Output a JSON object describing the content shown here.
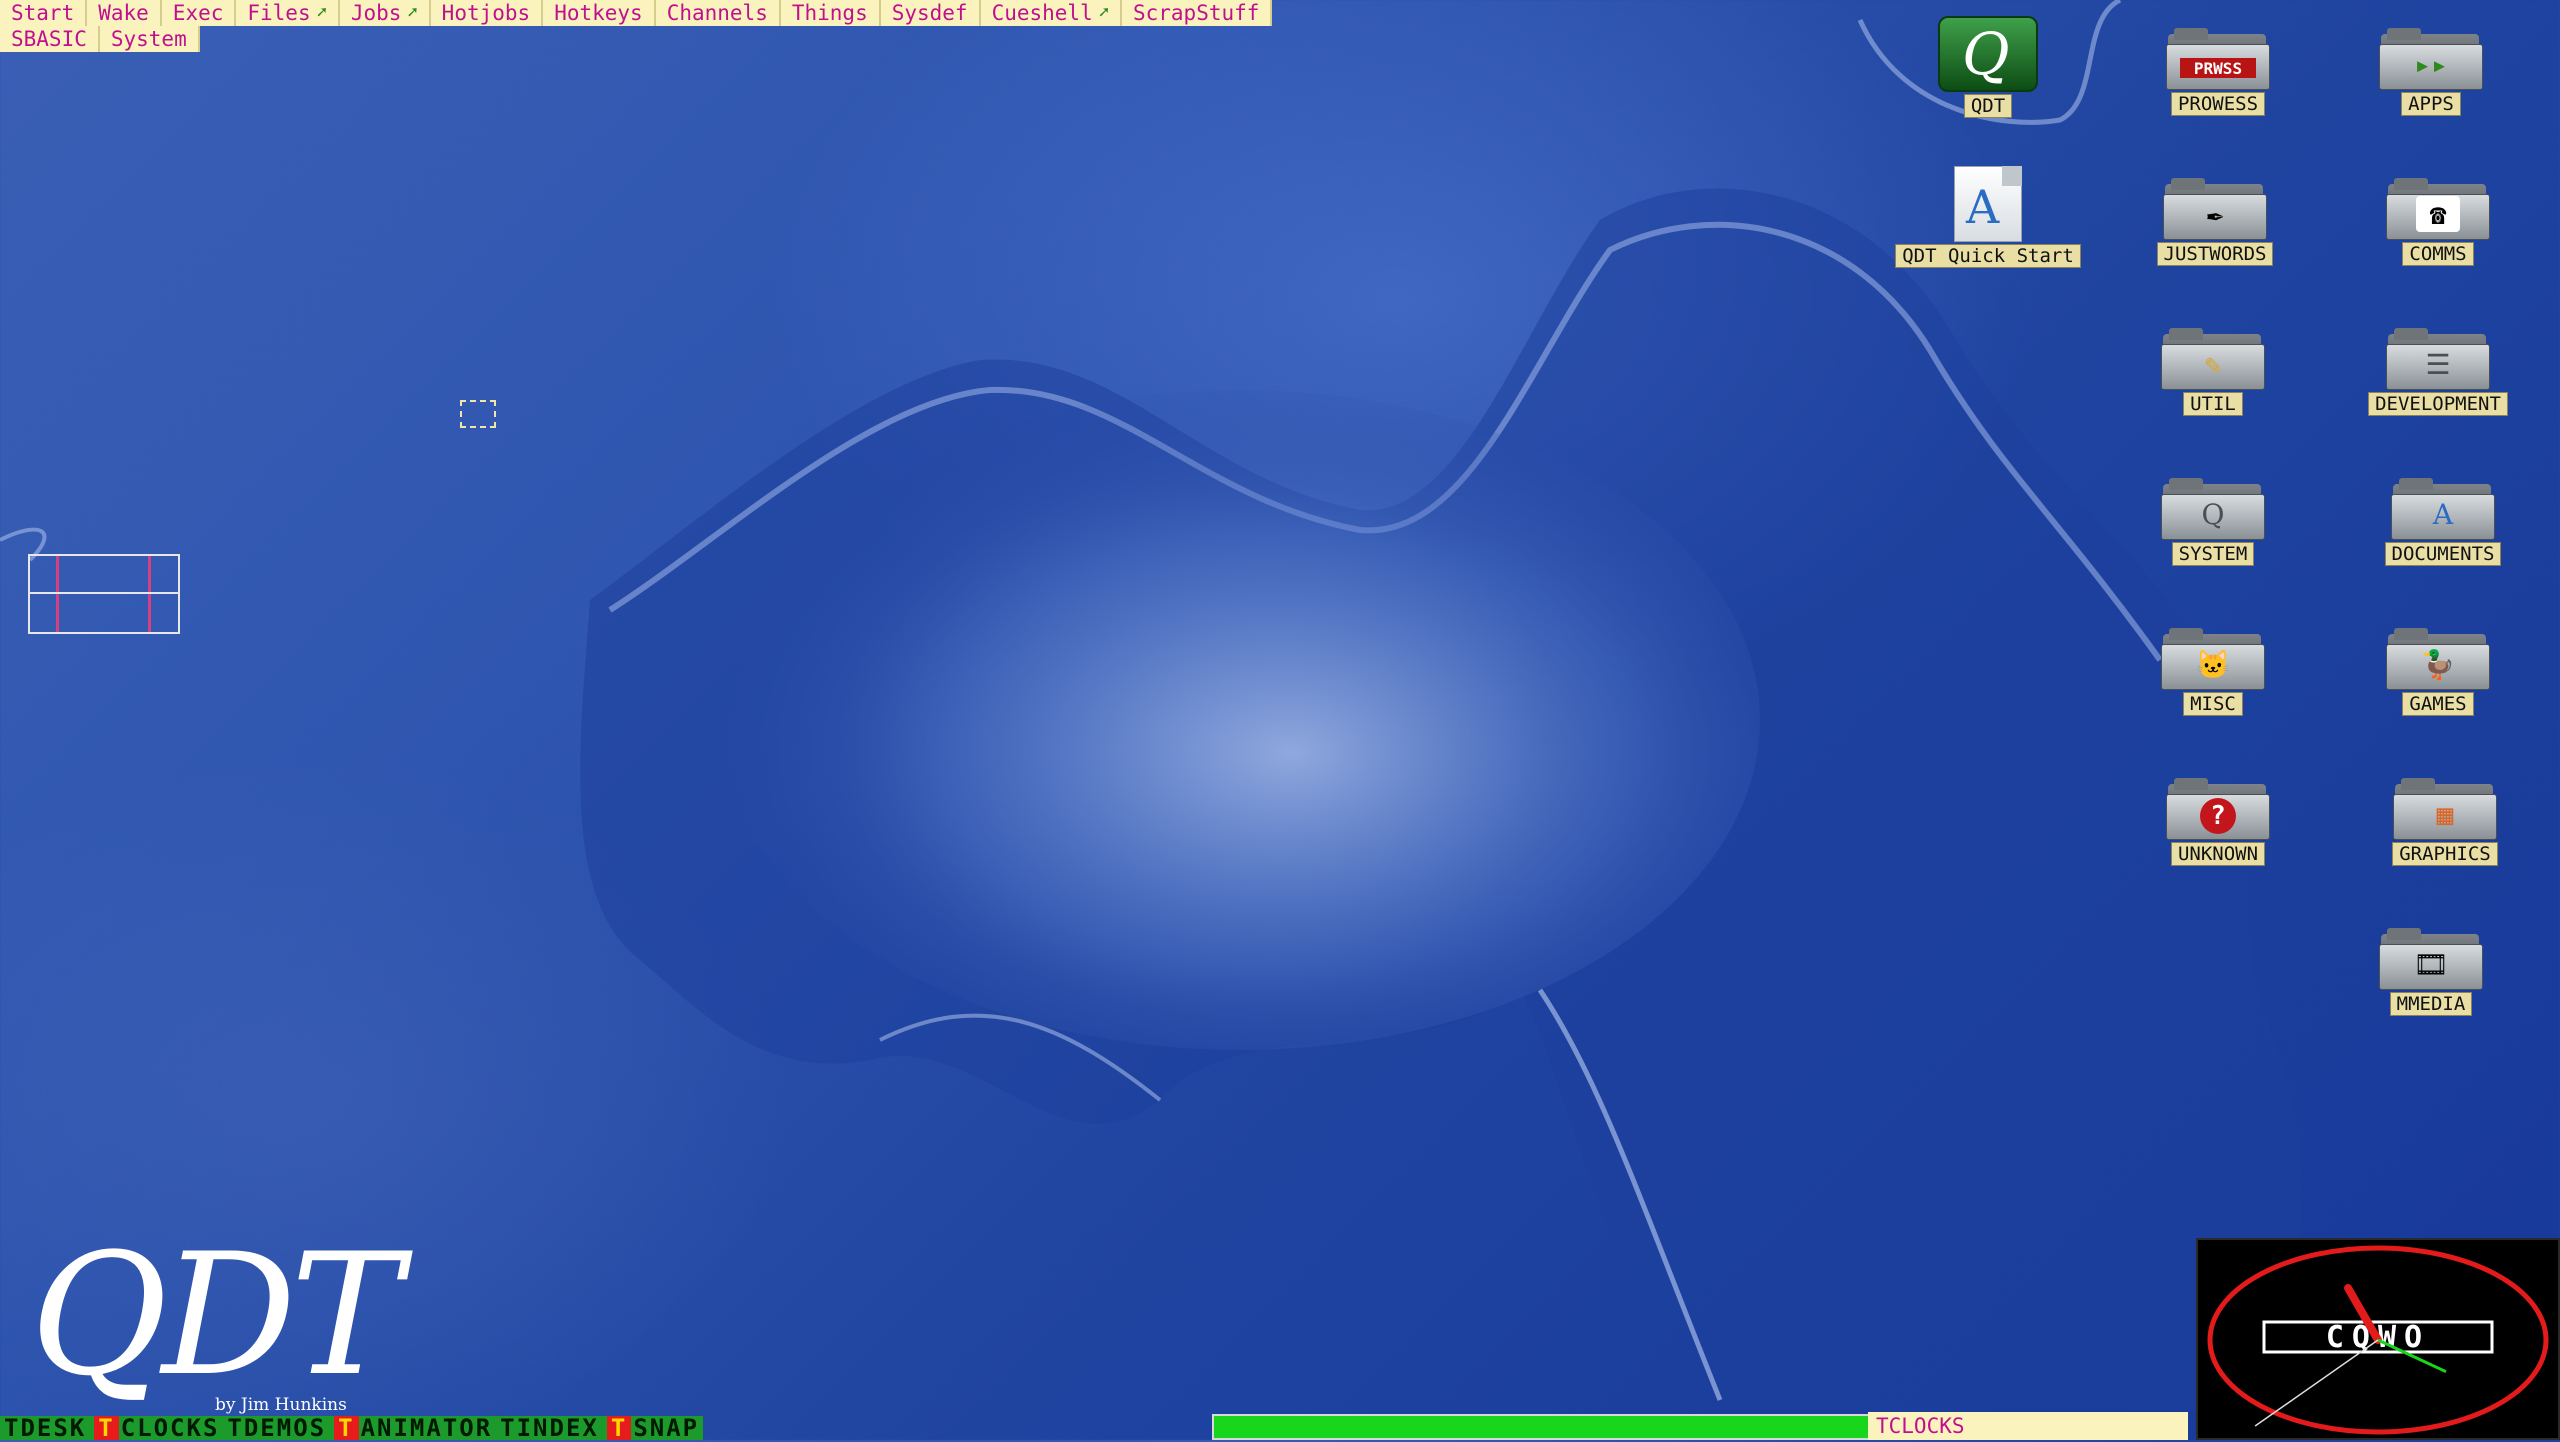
{
  "menubar": {
    "row1": [
      {
        "label": "Start"
      },
      {
        "label": "Wake"
      },
      {
        "label": "Exec"
      },
      {
        "label": "Files",
        "arrow": "➚"
      },
      {
        "label": "Jobs",
        "arrow": "➚"
      },
      {
        "label": "Hotjobs"
      },
      {
        "label": "Hotkeys"
      },
      {
        "label": "Channels"
      },
      {
        "label": "Things"
      },
      {
        "label": "Sysdef"
      },
      {
        "label": "Cueshell",
        "arrow": "➚"
      },
      {
        "label": "ScrapStuff"
      }
    ],
    "row2": [
      {
        "label": "SBASIC"
      },
      {
        "label": "System"
      }
    ]
  },
  "icons": {
    "qdt": {
      "label": "QDT",
      "icon": "qdt-app-icon"
    },
    "qdt_quick_start": {
      "label": "QDT Quick Start",
      "icon": "document-icon",
      "glyph": "A"
    },
    "prowess": {
      "label": "PROWESS",
      "icon": "folder-icon",
      "emblem": "PRWSS"
    },
    "apps": {
      "label": "APPS",
      "icon": "folder-icon",
      "emblem": "▸▸"
    },
    "justwords": {
      "label": "JUSTWORDS",
      "icon": "folder-icon",
      "emblem": "✒"
    },
    "comms": {
      "label": "COMMS",
      "icon": "folder-icon",
      "emblem": "☎"
    },
    "util": {
      "label": "UTIL",
      "icon": "folder-icon",
      "emblem": "✎"
    },
    "development": {
      "label": "DEVELOPMENT",
      "icon": "folder-icon",
      "emblem": "☰"
    },
    "system": {
      "label": "SYSTEM",
      "icon": "folder-icon",
      "emblem": "Q"
    },
    "documents": {
      "label": "DOCUMENTS",
      "icon": "folder-icon",
      "emblem": "A"
    },
    "misc": {
      "label": "MISC",
      "icon": "folder-icon",
      "emblem": "🐱"
    },
    "games": {
      "label": "GAMES",
      "icon": "folder-icon",
      "emblem": "🦆"
    },
    "unknown": {
      "label": "UNKNOWN",
      "icon": "folder-icon",
      "emblem": "?"
    },
    "graphics": {
      "label": "GRAPHICS",
      "icon": "folder-icon",
      "emblem": "▦"
    },
    "mmedia": {
      "label": "MMEDIA",
      "icon": "folder-icon",
      "emblem": "🎞"
    }
  },
  "logo": {
    "title": "QDT",
    "byline": "by Jim Hunkins"
  },
  "buttons": [
    {
      "label": "TDESK",
      "style": "green",
      "t": ""
    },
    {
      "label": "CLOCKS",
      "style": "green",
      "t": "T"
    },
    {
      "label": "TDEMOS",
      "style": "green",
      "t": ""
    },
    {
      "label": "ANIMATOR",
      "style": "green",
      "t": "T"
    },
    {
      "label": "TINDEX",
      "style": "green",
      "t": ""
    },
    {
      "label": "SNAP",
      "style": "green",
      "t": "T"
    }
  ],
  "progress": {
    "fraction": 1.0
  },
  "tclocks": {
    "label": "TCLOCKS"
  },
  "clock": {
    "brand": "CQWO",
    "hour_deg": -30,
    "minute_deg": 115,
    "second_deg": 235
  },
  "colors": {
    "menu_bg": "#fbf3bd",
    "menu_text": "#c01090",
    "label_bg": "#e9dfa5",
    "accent_green": "#18d61c"
  }
}
